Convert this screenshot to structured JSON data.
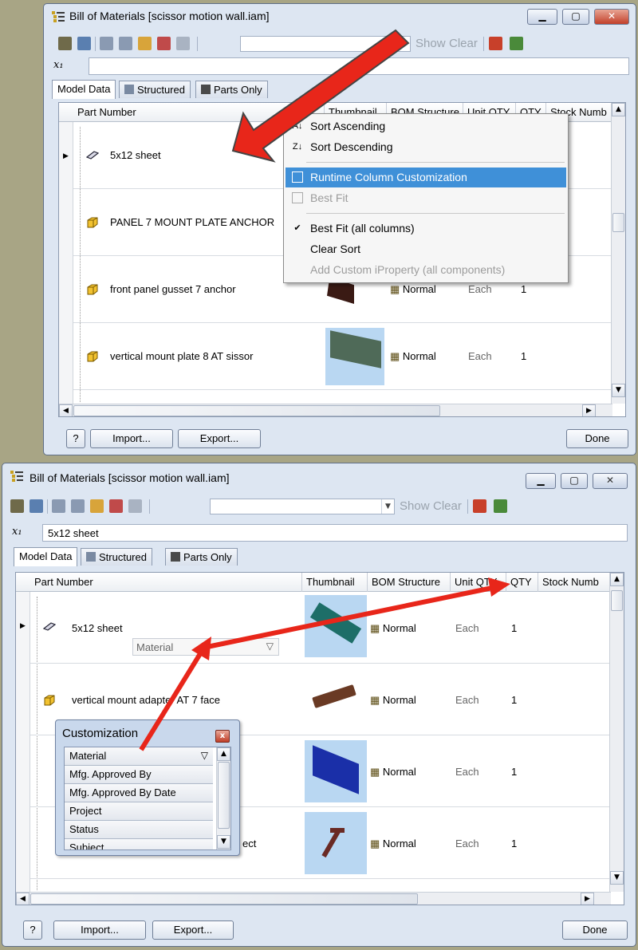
{
  "colors": {
    "arrow": "#e8261a",
    "highlight": "#3f90d8",
    "thumbnail_bg": "#b9d7f2"
  },
  "top_window": {
    "title": "Bill of Materials [scissor motion wall.iam]",
    "toolbar": {
      "show_label": "Show",
      "clear_label": "Clear"
    },
    "formula_value": "",
    "tabs": [
      "Model Data",
      "Structured",
      "Parts Only"
    ],
    "columns": [
      "Part Number",
      "Thumbnail",
      "BOM Structure",
      "Unit QTY",
      "QTY",
      "Stock Numb"
    ],
    "rows": [
      {
        "part": "5x12 sheet",
        "structure": "",
        "unit": "",
        "qty": ""
      },
      {
        "part": "PANEL 7 MOUNT PLATE ANCHOR",
        "structure": "",
        "unit": "",
        "qty": ""
      },
      {
        "part": "front panel gusset 7 anchor",
        "structure": "Normal",
        "unit": "Each",
        "qty": "1"
      },
      {
        "part": "vertical mount plate 8 AT sissor",
        "structure": "Normal",
        "unit": "Each",
        "qty": "1"
      }
    ],
    "context_menu": [
      {
        "label": "Sort Ascending",
        "icon": "sort-ascending-icon",
        "state": "normal"
      },
      {
        "label": "Sort Descending",
        "icon": "sort-descending-icon",
        "state": "normal"
      },
      {
        "label": "Runtime Column Customization",
        "icon": "column-customization-icon",
        "state": "highlighted"
      },
      {
        "label": "Best Fit",
        "icon": "best-fit-icon",
        "state": "disabled"
      },
      {
        "label": "Best Fit (all columns)",
        "icon": "checkmark-icon",
        "state": "checked"
      },
      {
        "label": "Clear Sort",
        "icon": "",
        "state": "normal"
      },
      {
        "label": "Add Custom iProperty (all components)",
        "icon": "",
        "state": "disabled"
      }
    ],
    "buttons": {
      "help": "?",
      "import": "Import...",
      "export": "Export...",
      "done": "Done"
    }
  },
  "bottom_window": {
    "title": "Bill of Materials [scissor motion wall.iam]",
    "toolbar": {
      "show_label": "Show",
      "clear_label": "Clear"
    },
    "formula_value": "5x12 sheet",
    "tabs": [
      "Model Data",
      "Structured",
      "Parts Only"
    ],
    "columns": [
      "Part Number",
      "Thumbnail",
      "BOM Structure",
      "Unit QTY",
      "QTY",
      "Stock Numb"
    ],
    "rows": [
      {
        "part": "5x12 sheet",
        "structure": "Normal",
        "unit": "Each",
        "qty": "1",
        "sub": "Material"
      },
      {
        "part": "vertical mount adapter AT 7 face",
        "structure": "Normal",
        "unit": "Each",
        "qty": "1"
      },
      {
        "part": "",
        "structure": "Normal",
        "unit": "Each",
        "qty": "1"
      },
      {
        "part": "ect",
        "structure": "Normal",
        "unit": "Each",
        "qty": "1"
      }
    ],
    "customization": {
      "title": "Customization",
      "items": [
        "Material",
        "Mfg. Approved By",
        "Mfg. Approved By Date",
        "Project",
        "Status",
        "Subject"
      ]
    },
    "buttons": {
      "help": "?",
      "import": "Import...",
      "export": "Export...",
      "done": "Done"
    }
  }
}
